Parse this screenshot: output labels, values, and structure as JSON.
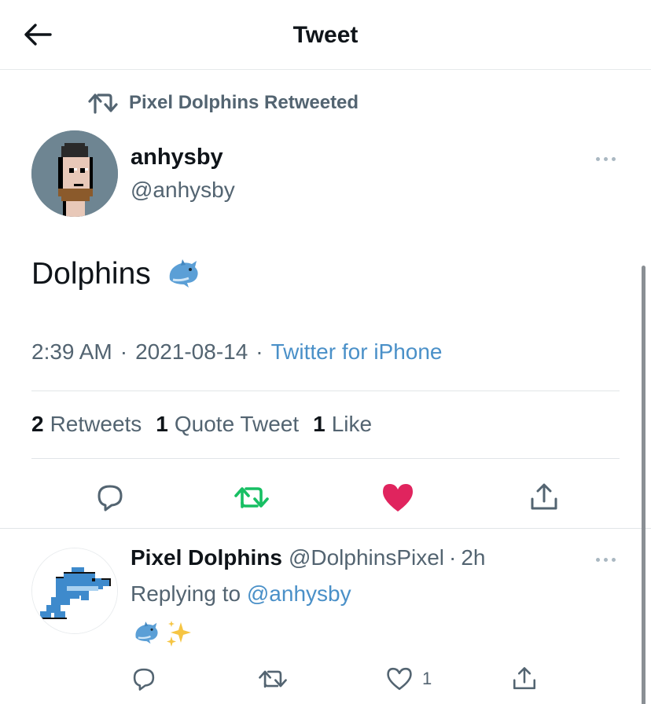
{
  "header": {
    "title": "Tweet"
  },
  "retweet_context": {
    "text": "Pixel Dolphins Retweeted"
  },
  "tweet": {
    "author_name": "anhysby",
    "author_handle": "@anhysby",
    "text": "Dolphins",
    "emoji": "dolphin-emoji",
    "time": "2:39 AM",
    "sep1": "·",
    "date": "2021-08-14",
    "sep2": "·",
    "source": "Twitter for iPhone",
    "stats": {
      "retweets_count": "2",
      "retweets_label": "Retweets",
      "quotes_count": "1",
      "quotes_label": "Quote Tweet",
      "likes_count": "1",
      "likes_label": "Like"
    },
    "actions": [
      {
        "icon": "reply-icon"
      },
      {
        "icon": "retweet-icon",
        "color": "#17bf63"
      },
      {
        "icon": "heart-filled-icon",
        "color": "#e0245e"
      },
      {
        "icon": "share-icon"
      }
    ]
  },
  "reply": {
    "author_name": "Pixel Dolphins",
    "author_handle": "@DolphinsPixel",
    "sep": "·",
    "time": "2h",
    "replying_prefix": "Replying to",
    "replying_mention": "@anhysby",
    "emojis": [
      "dolphin-emoji",
      "sparkles-emoji"
    ],
    "like_count": "1"
  },
  "colors": {
    "link": "#4a90c8",
    "secondary_text": "#536471",
    "retweet_green": "#17bf63",
    "like_red": "#e0245e"
  }
}
